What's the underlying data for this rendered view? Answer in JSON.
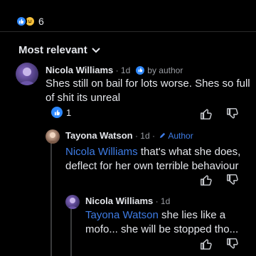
{
  "reactions_summary": {
    "count": "6",
    "icons": [
      "like-icon",
      "haha-icon"
    ]
  },
  "sort": {
    "label": "Most relevant",
    "icon": "chevron-down-icon"
  },
  "comments": [
    {
      "author": "Nicola Williams",
      "time": "1d",
      "liked_by": "by author",
      "text": "Shes still on bail for lots worse. Shes so full of shit its unreal",
      "reaction_count": "1"
    },
    {
      "author": "Tayona Watson",
      "time": "1d",
      "tag": "Author",
      "mention": "Nicola Williams",
      "text": " that's what she does, deflect for her own terrible behaviour"
    },
    {
      "author": "Nicola Williams",
      "time": "1d",
      "mention": "Tayona Watson",
      "text": " she lies like a mofo... she will be stopped tho..."
    }
  ],
  "colors": {
    "background": "#000000",
    "text": "#e4e6eb",
    "muted": "#9a9da3",
    "accent": "#3e7ce5",
    "like": "#2d88ff",
    "haha": "#f7c13b"
  }
}
